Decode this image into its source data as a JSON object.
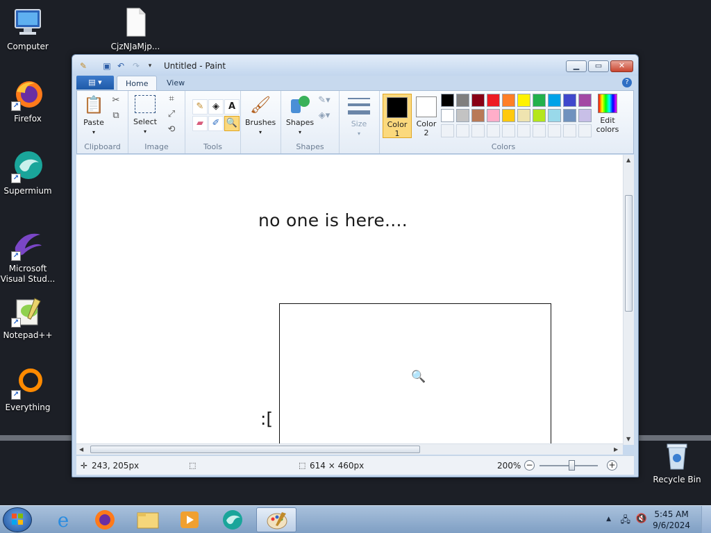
{
  "desktop": {
    "icons": [
      {
        "label": "Computer"
      },
      {
        "label": "CjzNJaMjp..."
      },
      {
        "label": "Firefox"
      },
      {
        "label": "Supermium"
      },
      {
        "label": "Microsoft Visual Stud..."
      },
      {
        "label": "Notepad++"
      },
      {
        "label": "Everything"
      },
      {
        "label": "Recycle Bin"
      }
    ]
  },
  "window": {
    "title": "Untitled - Paint",
    "tabs": {
      "home": "Home",
      "view": "View"
    },
    "ribbon": {
      "clipboard": {
        "paste": "Paste",
        "label": "Clipboard"
      },
      "image": {
        "select": "Select",
        "label": "Image"
      },
      "tools": {
        "label": "Tools"
      },
      "brushes": {
        "label": "Brushes"
      },
      "shapes": {
        "shapes": "Shapes",
        "label": "Shapes"
      },
      "size": {
        "label": "Size"
      },
      "colors": {
        "color1": "Color",
        "color1_num": "1",
        "color2": "Color",
        "color2_num": "2",
        "edit": "Edit",
        "edit2": "colors",
        "label": "Colors",
        "color1_value": "#000000",
        "color2_value": "#ffffff",
        "palette_row1": [
          "#000000",
          "#7f7f7f",
          "#880015",
          "#ed1c24",
          "#ff7f27",
          "#fff200",
          "#22b14c",
          "#00a2e8",
          "#3f48cc",
          "#a349a4"
        ],
        "palette_row2": [
          "#ffffff",
          "#c3c3c3",
          "#b97a57",
          "#ffaec9",
          "#ffc90e",
          "#efe4b0",
          "#b5e61d",
          "#99d9ea",
          "#7092be",
          "#c8bfe7"
        ]
      }
    },
    "canvas": {
      "text": "no one is here....",
      "face": ":["
    },
    "status": {
      "cursor_pos": "243, 205px",
      "selection_size": "",
      "image_size": "614 × 460px",
      "zoom": "200%"
    }
  },
  "taskbar": {
    "time": "5:45 AM",
    "date": "9/6/2024"
  }
}
